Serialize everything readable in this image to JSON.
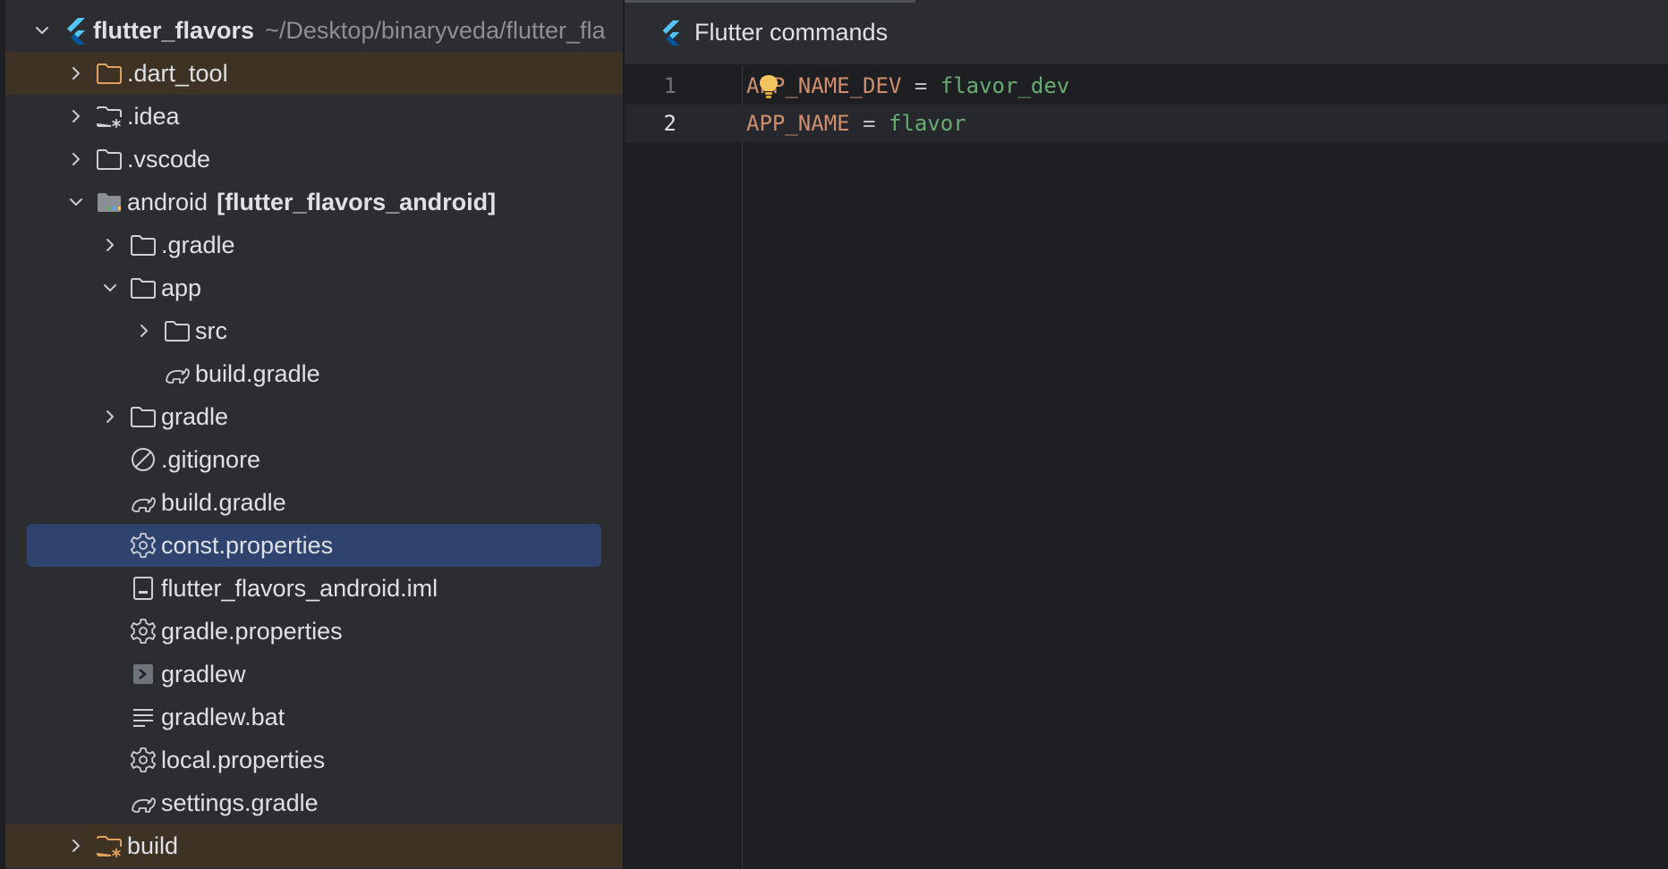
{
  "project_tree": {
    "root": {
      "name": "flutter_flavors",
      "path": "~/Desktop/binaryveda/flutter_fla"
    },
    "items": [
      {
        "label": ".dart_tool",
        "icon": "folder-excluded-icon"
      },
      {
        "label": ".idea",
        "icon": "folder-config-icon"
      },
      {
        "label": ".vscode",
        "icon": "folder-icon"
      },
      {
        "label": "android",
        "module": "[flutter_flavors_android]",
        "icon": "module-folder-icon"
      },
      {
        "label": ".gradle",
        "icon": "folder-icon"
      },
      {
        "label": "app",
        "icon": "folder-icon"
      },
      {
        "label": "src",
        "icon": "folder-icon"
      },
      {
        "label": "build.gradle",
        "icon": "gradle-elephant-icon"
      },
      {
        "label": "gradle",
        "icon": "folder-icon"
      },
      {
        "label": ".gitignore",
        "icon": "gitignore-icon"
      },
      {
        "label": "build.gradle",
        "icon": "gradle-elephant-icon"
      },
      {
        "label": "const.properties",
        "icon": "settings-gear-icon"
      },
      {
        "label": "flutter_flavors_android.iml",
        "icon": "iml-file-icon"
      },
      {
        "label": "gradle.properties",
        "icon": "settings-gear-icon"
      },
      {
        "label": "gradlew",
        "icon": "shell-script-icon"
      },
      {
        "label": "gradlew.bat",
        "icon": "text-file-icon"
      },
      {
        "label": "local.properties",
        "icon": "settings-gear-icon"
      },
      {
        "label": "settings.gradle",
        "icon": "gradle-elephant-icon"
      },
      {
        "label": "build",
        "icon": "folder-excluded-icon"
      }
    ]
  },
  "editor": {
    "header_title": "Flutter commands",
    "lines": [
      {
        "number": "1",
        "key": "APP_NAME_DEV",
        "op": "=",
        "value": "flavor_dev"
      },
      {
        "number": "2",
        "key": "APP_NAME",
        "op": "=",
        "value": "flavor"
      }
    ]
  },
  "colors": {
    "accent_selection": "#2e436e",
    "excluded_background": "#3d3223",
    "property_key": "#cf8e6d",
    "property_value": "#6aab73",
    "flutter_blue": "#54c5f8"
  }
}
